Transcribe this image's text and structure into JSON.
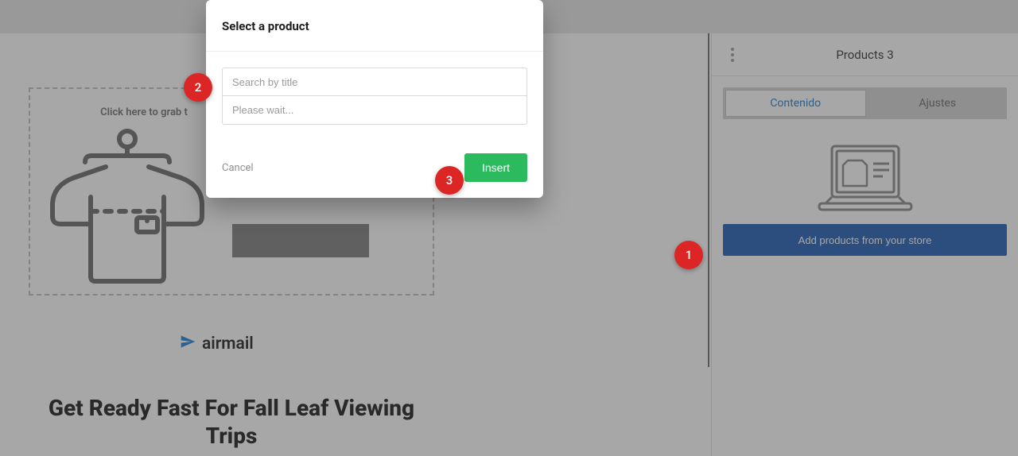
{
  "canvas": {
    "grab_text": "Click here to grab t",
    "brand": "airmail",
    "headline": "Get Ready Fast For Fall Leaf Viewing Trips"
  },
  "sidebar": {
    "title": "Products 3",
    "tabs": {
      "content": "Contenido",
      "settings": "Ajustes"
    },
    "add_button": "Add products from your store"
  },
  "modal": {
    "title": "Select a product",
    "search_placeholder": "Search by title",
    "wait_placeholder": "Please wait...",
    "cancel": "Cancel",
    "insert": "Insert"
  },
  "steps": {
    "one": "1",
    "two": "2",
    "three": "3"
  }
}
